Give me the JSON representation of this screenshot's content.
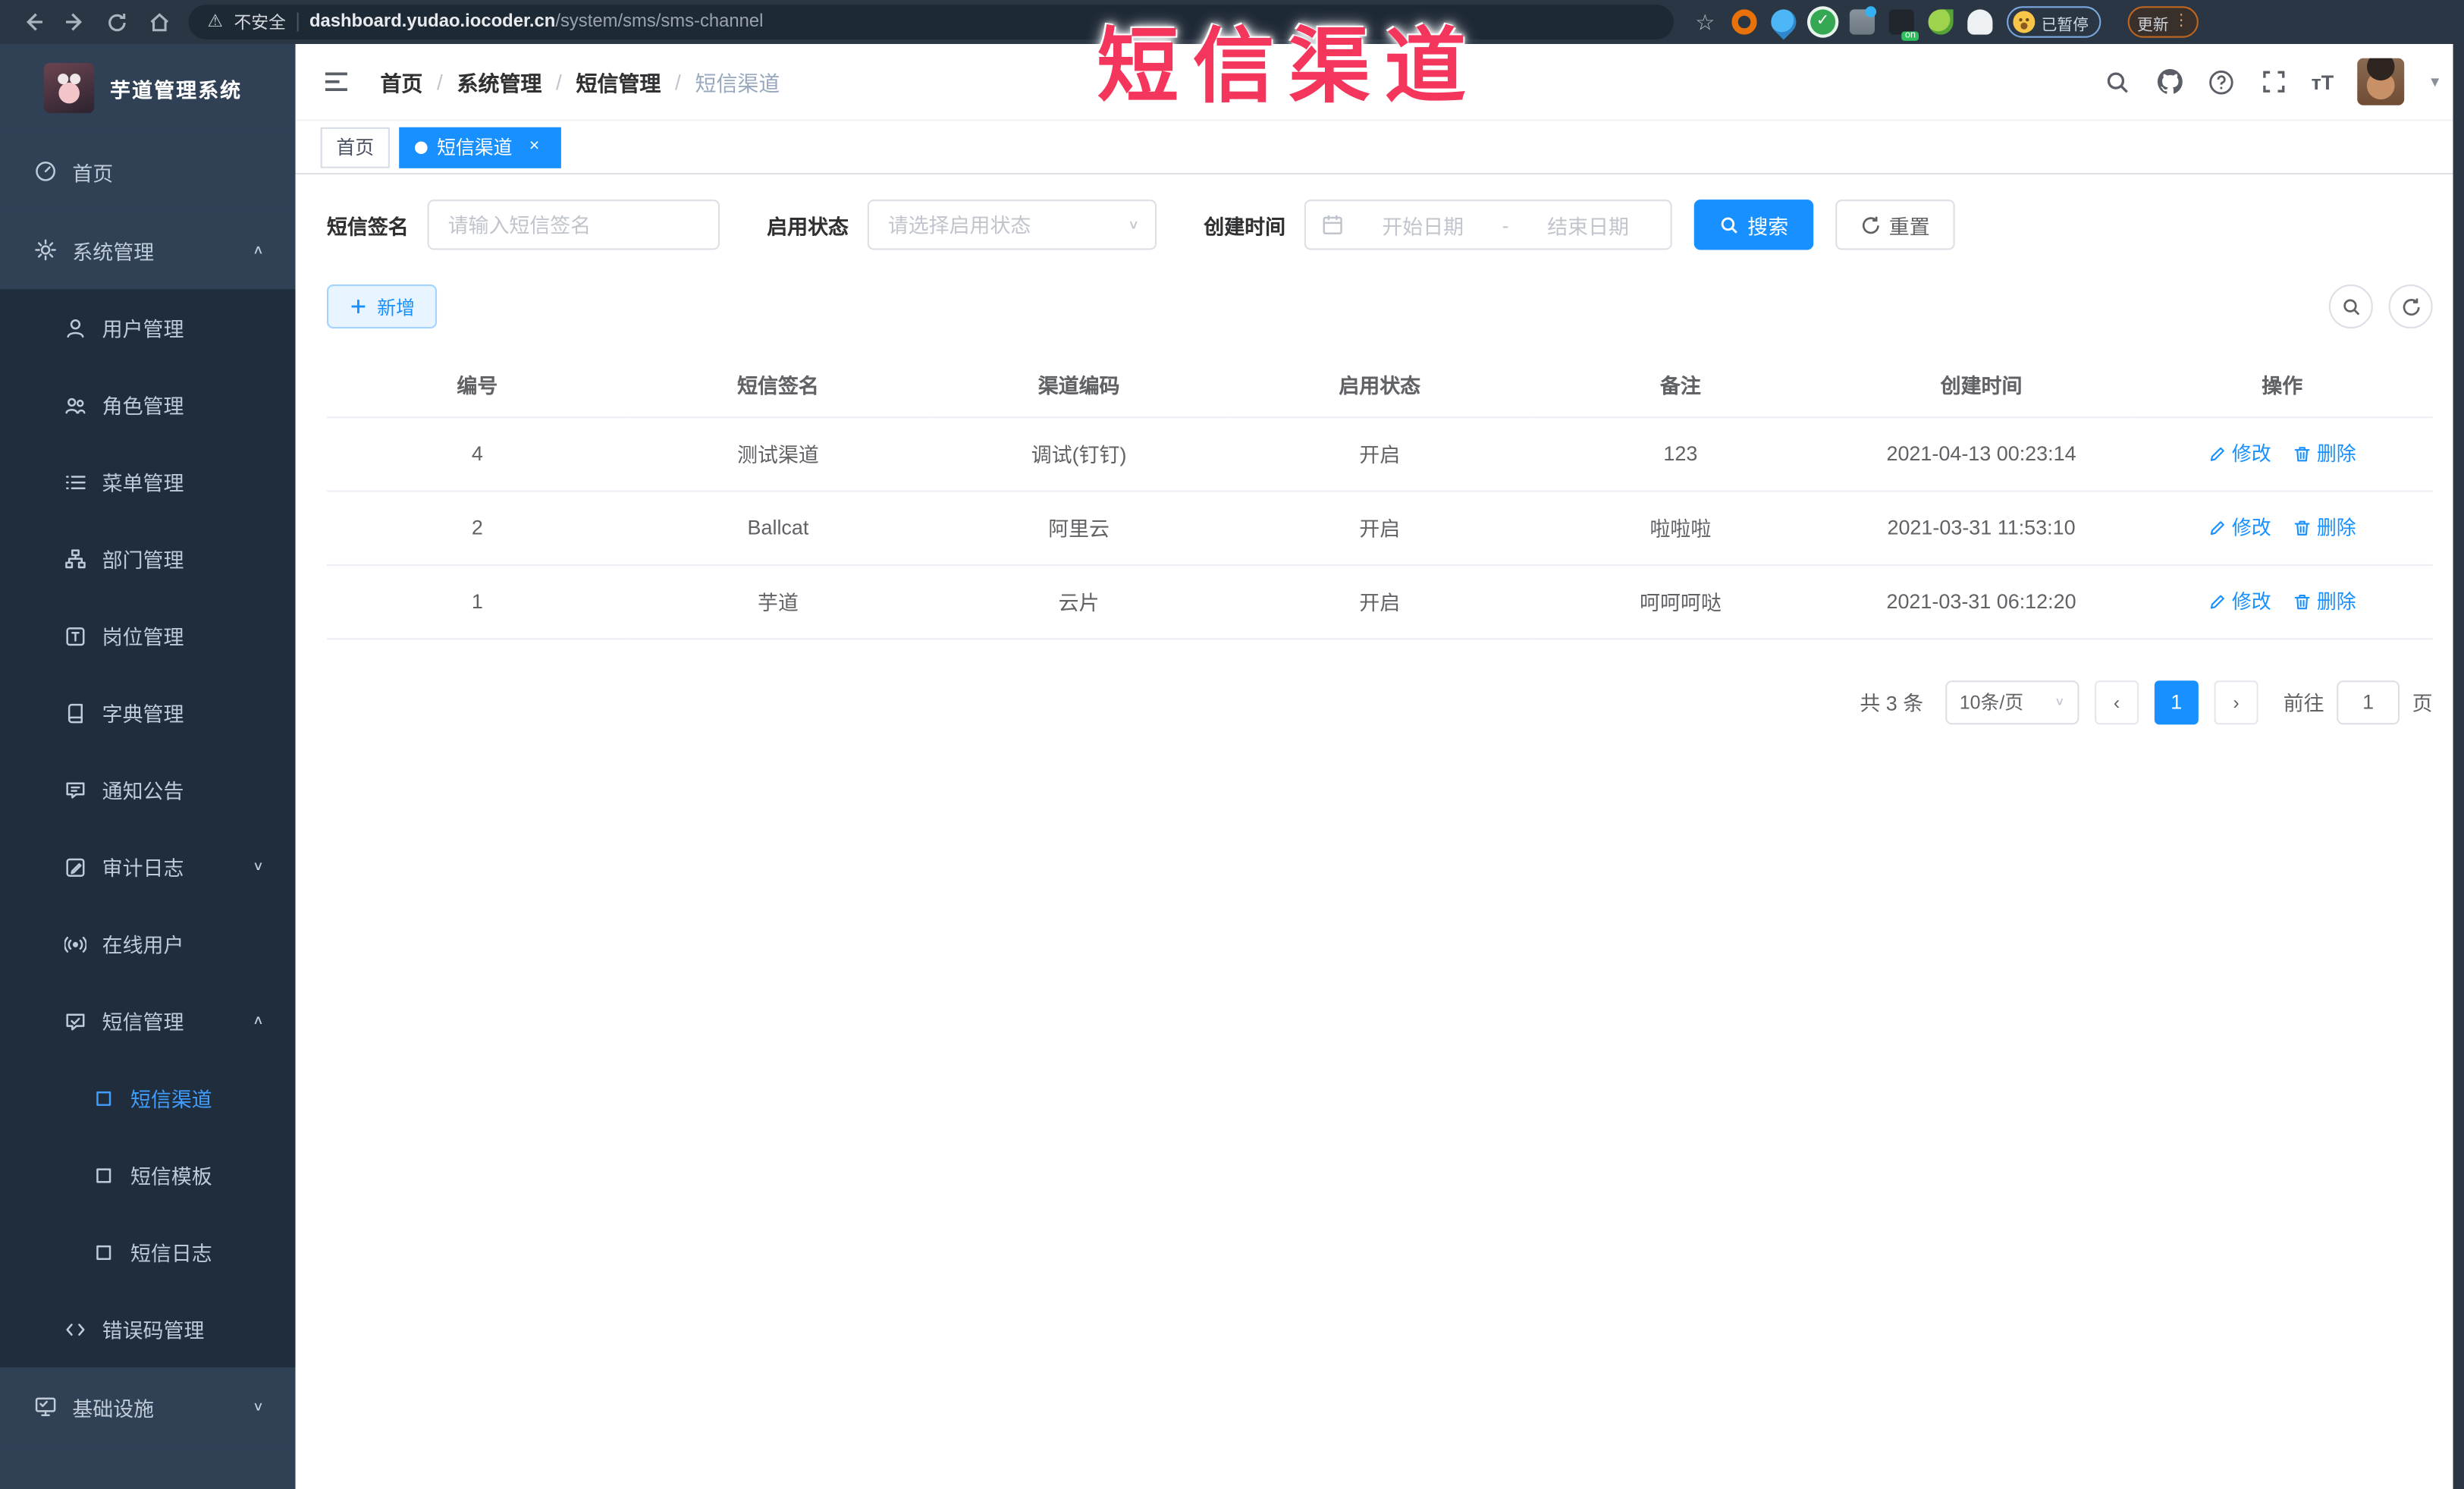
{
  "colors": {
    "accent": "#1890ff",
    "watermark": "#f5365c",
    "sidebar_bg": "#304156",
    "submenu_bg": "#1f2d3d",
    "sidebar_active": "#409eff"
  },
  "browser": {
    "security_label": "不安全",
    "url_host": "dashboard.yudao.iocoder.cn",
    "url_path": "/system/sms/sms-channel",
    "extension_icons": [
      "bookmark-star-icon",
      "orange-ring-extension-icon",
      "location-pin-extension-icon",
      "green-check-extension-icon",
      "sliders-extension-icon",
      "vpn-on-extension-icon",
      "leaf-extension-icon",
      "ghost-extension-icon"
    ],
    "paused_label": "已暂停",
    "update_label": "更新",
    "kebab_glyph": "⋮"
  },
  "watermark_text": "短信渠道",
  "sidebar": {
    "title": "芋道管理系统",
    "items": [
      {
        "label": "首页",
        "icon": "dashboard-icon",
        "level": 0
      },
      {
        "label": "系统管理",
        "icon": "gear-icon",
        "level": 0,
        "chevron": "up"
      },
      {
        "label": "用户管理",
        "icon": "user-icon",
        "level": 1
      },
      {
        "label": "角色管理",
        "icon": "users-icon",
        "level": 1
      },
      {
        "label": "菜单管理",
        "icon": "menu-list-icon",
        "level": 1
      },
      {
        "label": "部门管理",
        "icon": "org-tree-icon",
        "level": 1
      },
      {
        "label": "岗位管理",
        "icon": "post-badge-icon",
        "level": 1
      },
      {
        "label": "字典管理",
        "icon": "dictionary-icon",
        "level": 1
      },
      {
        "label": "通知公告",
        "icon": "announcement-icon",
        "level": 1
      },
      {
        "label": "审计日志",
        "icon": "audit-log-icon",
        "level": 1,
        "chevron": "down"
      },
      {
        "label": "在线用户",
        "icon": "online-users-icon",
        "level": 1
      },
      {
        "label": "短信管理",
        "icon": "sms-icon",
        "level": 1,
        "chevron": "up"
      },
      {
        "label": "短信渠道",
        "icon": "submenu-square-icon",
        "level": 2,
        "active": true
      },
      {
        "label": "短信模板",
        "icon": "submenu-square-icon",
        "level": 2
      },
      {
        "label": "短信日志",
        "icon": "submenu-square-icon",
        "level": 2
      },
      {
        "label": "错误码管理",
        "icon": "code-icon",
        "level": 1
      },
      {
        "label": "基础设施",
        "icon": "infrastructure-icon",
        "level": 0,
        "chevron": "down"
      }
    ]
  },
  "header": {
    "breadcrumb": [
      "首页",
      "系统管理",
      "短信管理",
      "短信渠道"
    ],
    "separator": "/"
  },
  "tabs": [
    {
      "label": "首页",
      "active": false,
      "closable": false
    },
    {
      "label": "短信渠道",
      "active": true,
      "closable": true,
      "close_glyph": "×"
    }
  ],
  "filters": {
    "sign_label": "短信签名",
    "sign_placeholder": "请输入短信签名",
    "status_label": "启用状态",
    "status_placeholder": "请选择启用状态",
    "time_label": "创建时间",
    "date_start_placeholder": "开始日期",
    "date_separator": "-",
    "date_end_placeholder": "结束日期",
    "search_label": "搜索",
    "reset_label": "重置"
  },
  "toolbar": {
    "add_label": "新增"
  },
  "table": {
    "headers": [
      "编号",
      "短信签名",
      "渠道编码",
      "启用状态",
      "备注",
      "创建时间",
      "操作"
    ],
    "rows": [
      {
        "id": "4",
        "signature": "测试渠道",
        "code": "调试(钉钉)",
        "status": "开启",
        "remark": "123",
        "created": "2021-04-13 00:23:14"
      },
      {
        "id": "2",
        "signature": "Ballcat",
        "code": "阿里云",
        "status": "开启",
        "remark": "啦啦啦",
        "created": "2021-03-31 11:53:10"
      },
      {
        "id": "1",
        "signature": "芋道",
        "code": "云片",
        "status": "开启",
        "remark": "呵呵呵哒",
        "created": "2021-03-31 06:12:20"
      }
    ],
    "action_edit": "修改",
    "action_delete": "删除"
  },
  "pagination": {
    "total_text": "共 3 条",
    "page_size_value": "10条/页",
    "prev_glyph": "‹",
    "current_page": "1",
    "next_glyph": "›",
    "goto_label": "前往",
    "goto_value": "1",
    "page_unit": "页"
  }
}
